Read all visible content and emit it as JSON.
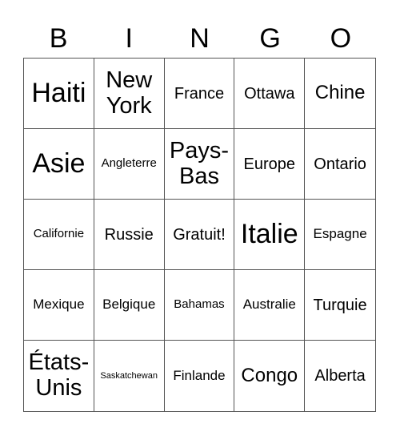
{
  "header": [
    "B",
    "I",
    "N",
    "G",
    "O"
  ],
  "cells": [
    [
      "Haiti",
      "New York",
      "France",
      "Ottawa",
      "Chine"
    ],
    [
      "Asie",
      "Angleterre",
      "Pays-Bas",
      "Europe",
      "Ontario"
    ],
    [
      "Californie",
      "Russie",
      "Gratuit!",
      "Italie",
      "Espagne"
    ],
    [
      "Mexique",
      "Belgique",
      "Bahamas",
      "Australie",
      "Turquie"
    ],
    [
      "États-Unis",
      "Saskatchewan",
      "Finlande",
      "Congo",
      "Alberta"
    ]
  ]
}
